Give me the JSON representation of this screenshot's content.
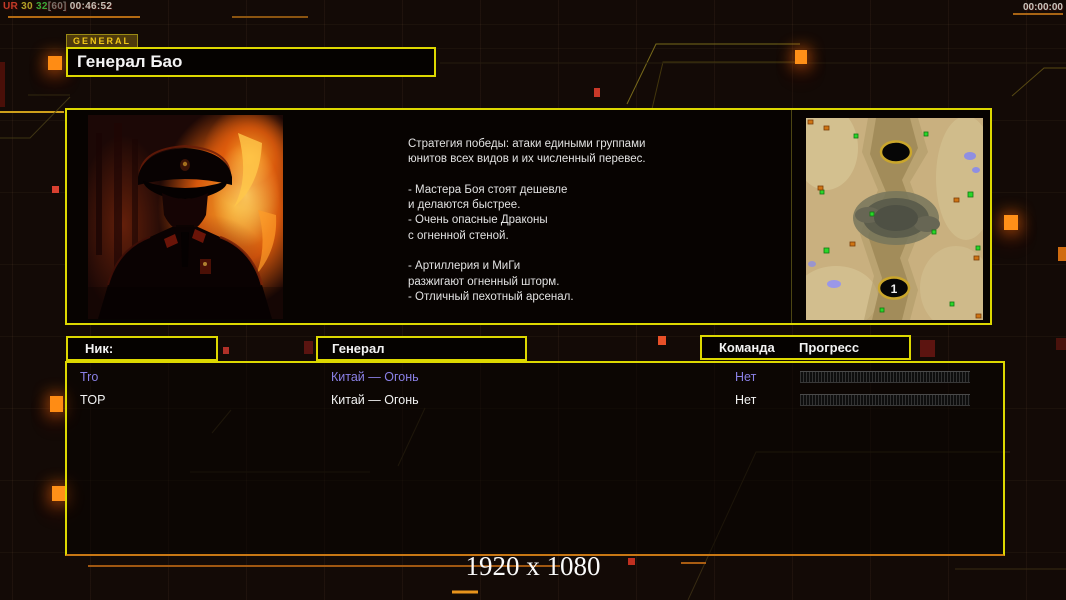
{
  "hud": {
    "fps_counter": {
      "label": "UR",
      "val1": "30",
      "val2": "32",
      "val3": "[60]",
      "time": "00:46:52"
    },
    "match_timer": "00:00:00"
  },
  "header": {
    "tab_label": "GENERAL",
    "general_name": "Генерал Бао"
  },
  "info_panel": {
    "portrait_name": "general-bao-portrait",
    "strategy_text": "Стратегия победы: атаки едиными группами\nюнитов всех видов и их численный перевес.\n\n- Мастера Боя стоят дешевле\nи делаются быстрее.\n- Очень опасные Драконы\nс огненной стеной.\n\n- Артиллерия и МиГи\nразжигают огненный шторм.\n- Отличный пехотный арсенал.",
    "minimap": {
      "start_marker_bottom": "1"
    }
  },
  "lobby": {
    "columns": {
      "nick": "Ник:",
      "general": "Генерал",
      "team": "Команда",
      "progress": "Прогресс"
    },
    "players": [
      {
        "nick": "Tro",
        "general": "Китай — Огонь",
        "team": "Нет",
        "progress_percent": 0
      },
      {
        "nick": "TOP",
        "general": "Китай — Огонь",
        "team": "Нет",
        "progress_percent": 0
      }
    ]
  },
  "footer": {
    "resolution_label": "1920 x 1080"
  },
  "colors": {
    "accent_yellow": "#ddd800",
    "accent_orange": "#ff8c14",
    "player_remote_text": "#8a80e6",
    "player_local_text": "#f2f2f2"
  }
}
